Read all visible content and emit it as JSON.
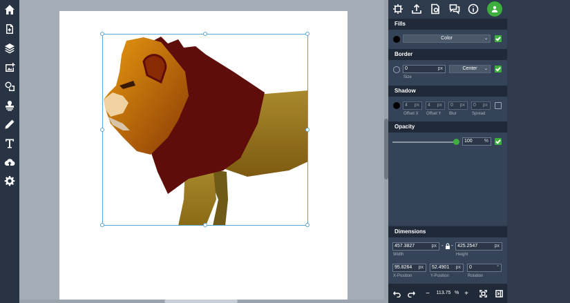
{
  "toolbar": {
    "items": [
      {
        "name": "home-icon",
        "label": "Home"
      },
      {
        "name": "add-page-icon",
        "label": "Add Page"
      },
      {
        "name": "layers-icon",
        "label": "Layers"
      },
      {
        "name": "add-image-icon",
        "label": "Add Image"
      },
      {
        "name": "shapes-icon",
        "label": "Shapes"
      },
      {
        "name": "stamp-icon",
        "label": "Stamp"
      },
      {
        "name": "pencil-icon",
        "label": "Draw"
      },
      {
        "name": "text-icon",
        "label": "Text"
      },
      {
        "name": "cloud-upload-icon",
        "label": "Cloud"
      },
      {
        "name": "gear-icon",
        "label": "Settings"
      }
    ]
  },
  "topbar": {
    "icons": [
      "effects-icon",
      "upload-icon",
      "save-file-icon",
      "comments-icon",
      "info-icon",
      "profile-icon"
    ]
  },
  "fills": {
    "title": "Fills",
    "color": "#000000",
    "type_value": "Color",
    "enabled": true
  },
  "border": {
    "title": "Border",
    "size_value": "0",
    "size_unit": "px",
    "size_label": "Size",
    "position_value": "Center",
    "enabled": true
  },
  "shadow": {
    "title": "Shadow",
    "color": "#000000",
    "offset_x": "4",
    "offset_y": "4",
    "blur": "0",
    "spread": "0",
    "unit": "px",
    "offset_x_label": "Offset X",
    "offset_y_label": "Offset Y",
    "blur_label": "Blur",
    "spread_label": "Spread",
    "enabled": false
  },
  "opacity": {
    "title": "Opacity",
    "value": "100",
    "unit": "%",
    "level_percent": 100,
    "enabled": true
  },
  "dimensions": {
    "title": "Dimensions",
    "width_value": "457.3827",
    "height_value": "425.2547",
    "x_value": "95.8264",
    "y_value": "52.4901",
    "rotation_value": "0",
    "unit": "px",
    "rotation_unit": "°",
    "link_separator": "-",
    "width_label": "Width",
    "height_label": "Height",
    "x_label": "X-Position",
    "y_label": "Y-Position",
    "rotation_label": "Rotation"
  },
  "zoom": {
    "value": "113.75",
    "unit": "%",
    "minus": "−",
    "plus": "+"
  },
  "colors": {
    "accent_green": "#3eae3e",
    "panel_bg": "#2e3b4c",
    "header_bg": "#1f2937",
    "selection": "#58a6d6"
  }
}
